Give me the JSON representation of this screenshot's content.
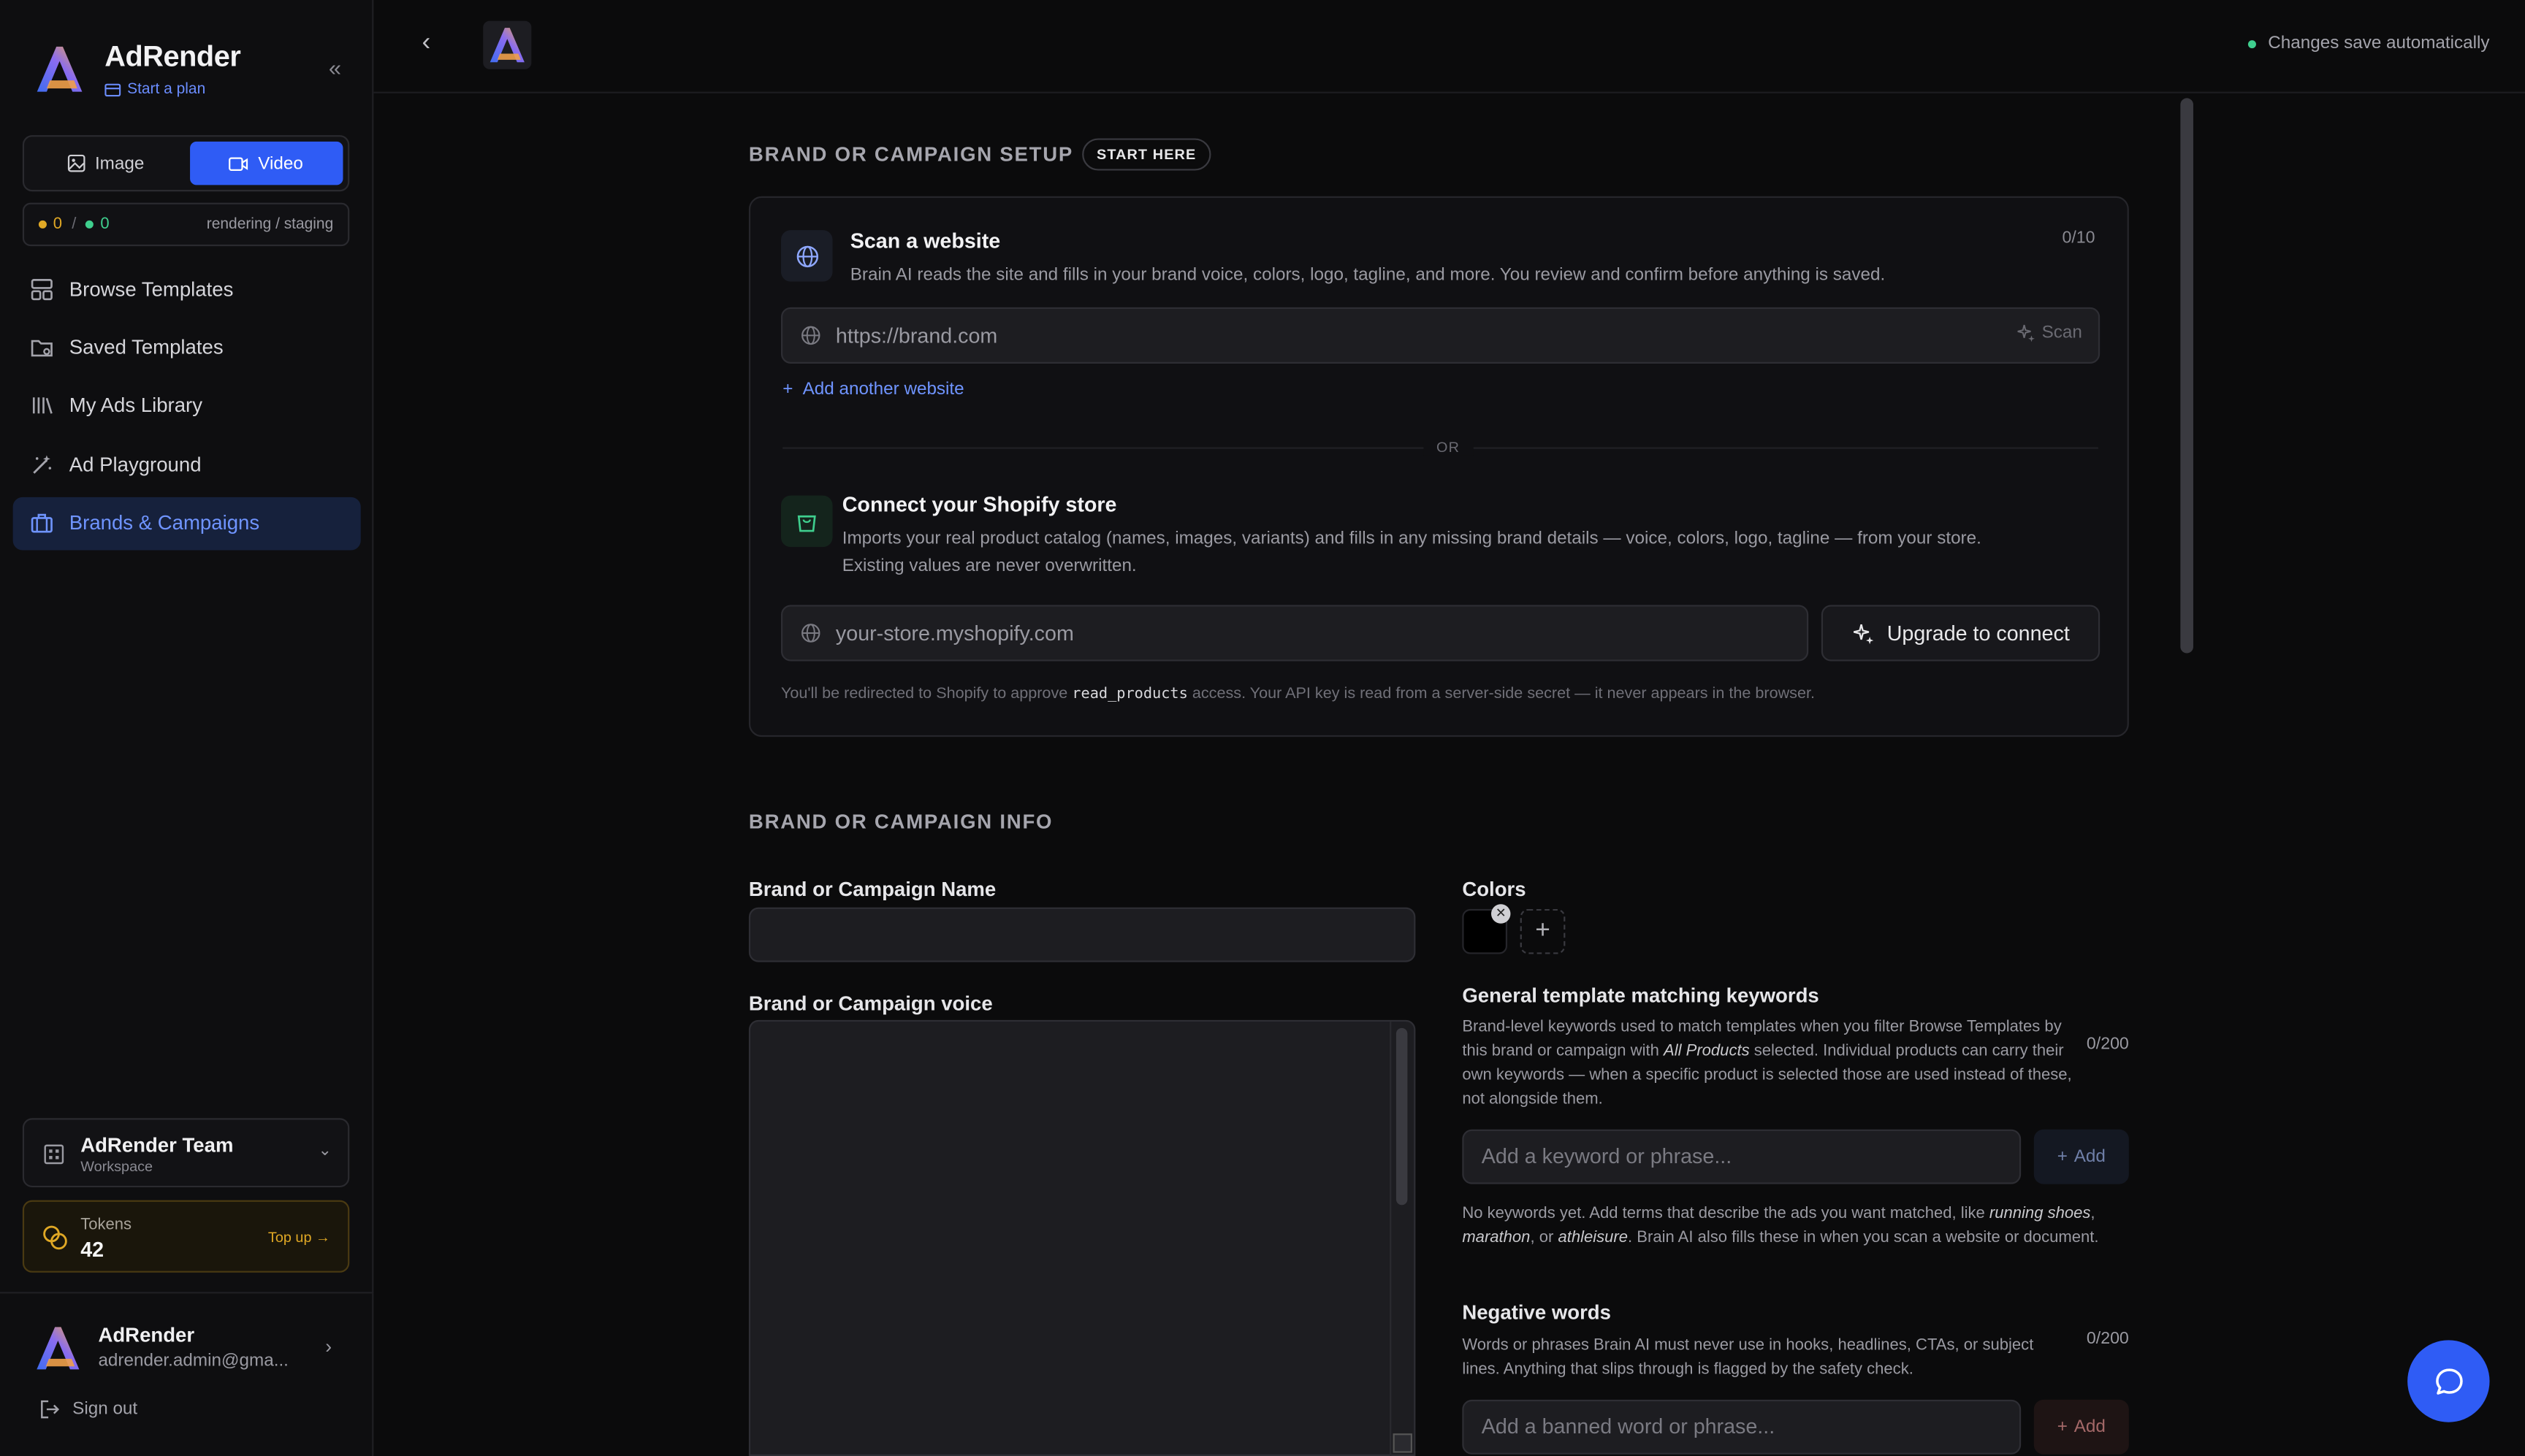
{
  "app": {
    "name": "AdRender",
    "plan_link": "Start a plan"
  },
  "mode": {
    "image_label": "Image",
    "video_label": "Video",
    "active": "Video"
  },
  "queue": {
    "rendering_count": "0",
    "separator": "/",
    "staging_count": "0",
    "label": "rendering / staging"
  },
  "nav": [
    {
      "label": "Browse Templates",
      "icon": "grid-icon"
    },
    {
      "label": "Saved Templates",
      "icon": "folder-icon"
    },
    {
      "label": "My Ads Library",
      "icon": "library-icon"
    },
    {
      "label": "Ad Playground",
      "icon": "wand-icon"
    },
    {
      "label": "Brands & Campaigns",
      "icon": "briefcase-icon",
      "active": true
    }
  ],
  "workspace": {
    "name": "AdRender Team",
    "sub": "Workspace"
  },
  "tokens": {
    "label": "Tokens",
    "value": "42",
    "topup": "Top up →"
  },
  "user": {
    "name": "AdRender",
    "email": "adrender.admin@gma..."
  },
  "signout": "Sign out",
  "topbar": {
    "autosave": "Changes save automatically"
  },
  "setup": {
    "heading": "BRAND OR CAMPAIGN SETUP",
    "pill": "START HERE",
    "scan": {
      "title": "Scan a website",
      "desc": "Brain AI reads the site and fills in your brand voice, colors, logo, tagline, and more. You review and confirm before anything is saved.",
      "counter": "0/10",
      "placeholder": "https://brand.com",
      "button": "Scan",
      "add_another": "Add another website"
    },
    "or": "OR",
    "shopify": {
      "title": "Connect your Shopify store",
      "desc_line1": "Imports your real product catalog (names, images, variants) and fills in any missing brand details — voice, colors, logo, tagline — from your store.",
      "desc_line2": "Existing values are never overwritten.",
      "placeholder": "your-store.myshopify.com",
      "button": "Upgrade to connect",
      "note_pre": "You'll be redirected to Shopify to approve",
      "note_code": "read_products",
      "note_post": "access. Your API key is read from a server-side secret — it never appears in the browser."
    }
  },
  "info": {
    "heading": "BRAND OR CAMPAIGN INFO",
    "name_label": "Brand or Campaign Name",
    "voice_label": "Brand or Campaign voice",
    "colors_label": "Colors",
    "colors": [
      "#000000"
    ],
    "keywords": {
      "title": "General template matching keywords",
      "desc_pre": "Brand-level keywords used to match templates when you filter Browse Templates by this brand or campaign with",
      "desc_em": "All Products",
      "desc_post": "selected. Individual products can carry their own keywords — when a specific product is selected those are used instead of these, not alongside them.",
      "counter": "0/200",
      "placeholder": "Add a keyword or phrase...",
      "add": "Add",
      "empty_pre": "No keywords yet. Add terms that describe the ads you want matched, like",
      "empty_e1": "running shoes",
      "empty_e2": "marathon",
      "empty_mid": "or",
      "empty_e3": "athleisure",
      "empty_post": ". Brain AI also fills these in when you scan a website or document."
    },
    "negative": {
      "title": "Negative words",
      "desc": "Words or phrases Brain AI must never use in hooks, headlines, CTAs, or subject lines. Anything that slips through is flagged by the safety check.",
      "counter": "0/200",
      "placeholder": "Add a banned word or phrase...",
      "add": "Add"
    }
  }
}
